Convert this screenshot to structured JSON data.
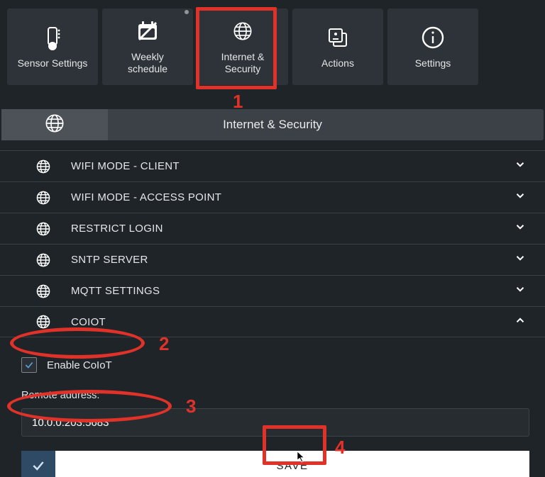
{
  "tabs": [
    {
      "label": "Sensor Settings"
    },
    {
      "label": "Weekly\nschedule"
    },
    {
      "label": "Internet &\nSecurity"
    },
    {
      "label": "Actions"
    },
    {
      "label": "Settings"
    }
  ],
  "section_title": "Internet & Security",
  "accordion": [
    {
      "label": "WIFI MODE - CLIENT",
      "expanded": false
    },
    {
      "label": "WIFI MODE - ACCESS POINT",
      "expanded": false
    },
    {
      "label": "RESTRICT LOGIN",
      "expanded": false
    },
    {
      "label": "SNTP SERVER",
      "expanded": false
    },
    {
      "label": "MQTT SETTINGS",
      "expanded": false
    },
    {
      "label": "COIOT",
      "expanded": true
    }
  ],
  "coiot": {
    "enable_label": "Enable CoIoT",
    "enable_checked": true,
    "remote_label": "Remote address:",
    "remote_value": "10.0.0.203:5683",
    "save_label": "SAVE"
  },
  "annotations": {
    "n1": "1",
    "n2": "2",
    "n3": "3",
    "n4": "4"
  }
}
